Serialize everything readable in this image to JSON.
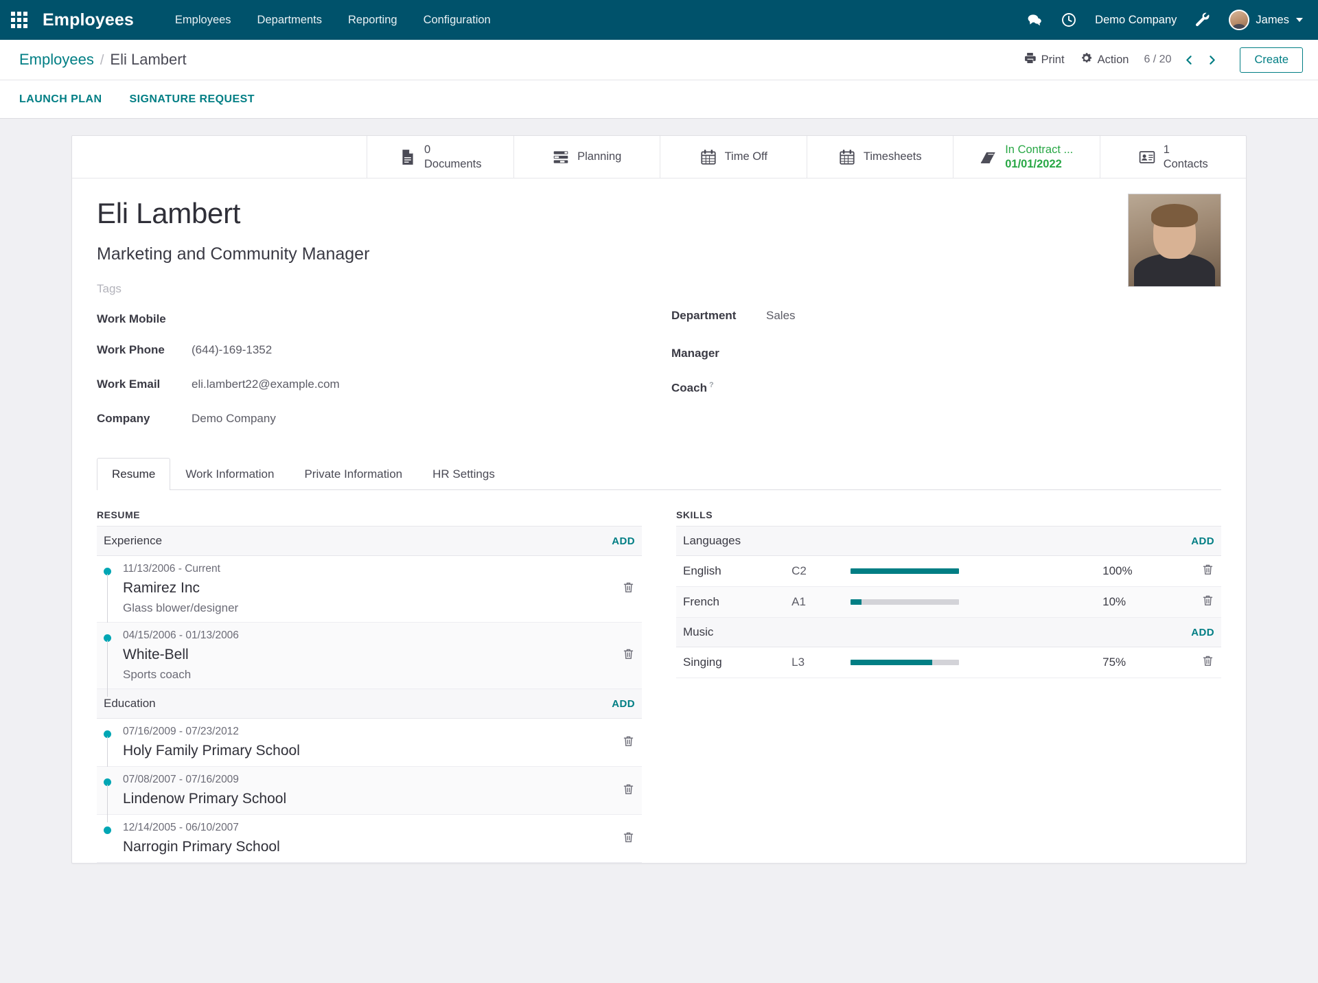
{
  "navbar": {
    "apps_icon": "apps-grid-icon",
    "brand": "Employees",
    "menu": [
      {
        "label": "Employees"
      },
      {
        "label": "Departments"
      },
      {
        "label": "Reporting"
      },
      {
        "label": "Configuration"
      }
    ],
    "messages_icon": "chat-bubbles-icon",
    "activities_icon": "clock-icon",
    "company": "Demo Company",
    "debug_icon": "wrench-icon",
    "user": "James"
  },
  "control_panel": {
    "breadcrumb_root": "Employees",
    "breadcrumb_sep": "/",
    "breadcrumb_current": "Eli Lambert",
    "print_label": "Print",
    "action_label": "Action",
    "pager": "6 / 20",
    "prev_icon": "chevron-left-icon",
    "next_icon": "chevron-right-icon",
    "create_label": "Create"
  },
  "action_strip": [
    {
      "label": "LAUNCH PLAN"
    },
    {
      "label": "SIGNATURE REQUEST"
    }
  ],
  "smart_buttons": [
    {
      "icon": "document-icon",
      "value": "0",
      "label": "Documents",
      "green": false
    },
    {
      "icon": "planning-icon",
      "value": "",
      "label": "Planning",
      "green": false
    },
    {
      "icon": "calendar-icon",
      "value": "",
      "label": "Time Off",
      "green": false
    },
    {
      "icon": "calendar-icon",
      "value": "",
      "label": "Timesheets",
      "green": false
    },
    {
      "icon": "book-icon",
      "value": "In Contract ...",
      "label": "01/01/2022",
      "green": true
    },
    {
      "icon": "contact-card-icon",
      "value": "1",
      "label": "Contacts",
      "green": false
    }
  ],
  "employee": {
    "name": "Eli Lambert",
    "job_title": "Marketing and Community Manager",
    "tags_placeholder": "Tags",
    "photo": "employee-photo"
  },
  "fields_left": [
    {
      "label": "Work Mobile",
      "value": ""
    },
    {
      "label": "Work Phone",
      "value": "(644)-169-1352"
    },
    {
      "label": "Work Email",
      "value": "eli.lambert22@example.com"
    },
    {
      "label": "Company",
      "value": "Demo Company"
    }
  ],
  "fields_right": [
    {
      "label": "Department",
      "value": "Sales",
      "help": ""
    },
    {
      "label": "Manager",
      "value": "",
      "help": ""
    },
    {
      "label": "Coach",
      "value": "",
      "help": "?"
    }
  ],
  "tabs": [
    {
      "label": "Resume",
      "active": true
    },
    {
      "label": "Work Information",
      "active": false
    },
    {
      "label": "Private Information",
      "active": false
    },
    {
      "label": "HR Settings",
      "active": false
    }
  ],
  "resume": {
    "section_title": "RESUME",
    "groups": [
      {
        "name": "Experience",
        "add_label": "ADD",
        "entries": [
          {
            "date": "11/13/2006 - Current",
            "title": "Ramirez Inc",
            "desc": "Glass blower/designer",
            "delete_icon": "trash-icon"
          },
          {
            "date": "04/15/2006 - 01/13/2006",
            "title": "White-Bell",
            "desc": "Sports coach",
            "delete_icon": "trash-icon"
          }
        ]
      },
      {
        "name": "Education",
        "add_label": "ADD",
        "entries": [
          {
            "date": "07/16/2009 - 07/23/2012",
            "title": "Holy Family Primary School",
            "desc": "",
            "delete_icon": "trash-icon"
          },
          {
            "date": "07/08/2007 - 07/16/2009",
            "title": "Lindenow Primary School",
            "desc": "",
            "delete_icon": "trash-icon"
          },
          {
            "date": "12/14/2005 - 06/10/2007",
            "title": "Narrogin Primary School",
            "desc": "",
            "delete_icon": "trash-icon"
          }
        ]
      }
    ]
  },
  "skills": {
    "section_title": "SKILLS",
    "groups": [
      {
        "name": "Languages",
        "add_label": "ADD",
        "entries": [
          {
            "name": "English",
            "level": "C2",
            "percent": "100%",
            "value": 100,
            "delete_icon": "trash-icon"
          },
          {
            "name": "French",
            "level": "A1",
            "percent": "10%",
            "value": 10,
            "delete_icon": "trash-icon"
          }
        ]
      },
      {
        "name": "Music",
        "add_label": "ADD",
        "entries": [
          {
            "name": "Singing",
            "level": "L3",
            "percent": "75%",
            "value": 75,
            "delete_icon": "trash-icon"
          }
        ]
      }
    ]
  },
  "colors": {
    "navbar": "#00526b",
    "accent": "#017e84",
    "green": "#28a745",
    "timeline_dot": "#00a6b4"
  }
}
